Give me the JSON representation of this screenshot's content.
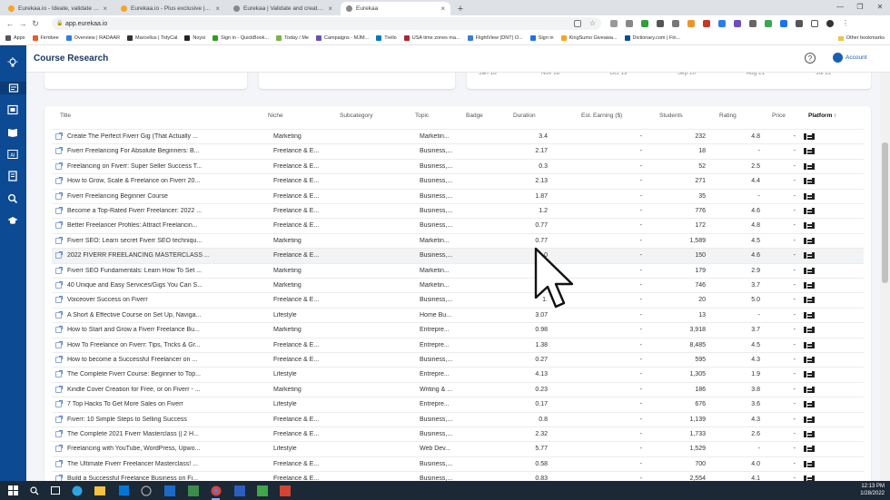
{
  "browser": {
    "tabs": [
      {
        "title": "Eurekaa.io - Ideate, validate & ...",
        "active": false,
        "favicon_color": "#f5a623"
      },
      {
        "title": "Eurekaa.io - Plus exclusive | App...",
        "active": false,
        "favicon_color": "#f5a623"
      },
      {
        "title": "Eurekaa | Validate and create co...",
        "active": false,
        "favicon_color": "#888888"
      },
      {
        "title": "Eurekaa",
        "active": true,
        "favicon_color": "#888888"
      }
    ],
    "url": "app.eurekaa.io",
    "bookmarks": [
      "Apps",
      "Firmbee",
      "Overview | RADAAR",
      "Marcellus | TidyCal",
      "Noysi",
      "Sign in - QuickBook...",
      "Today / Me",
      "Campaigns - MJM...",
      "Trello",
      "USA time zones ma...",
      "FlightView (DNT) O...",
      "Sign in",
      "KingSumo Giveawa...",
      "Dictionary.com | Fin..."
    ],
    "other_bookmarks": "Other bookmarks"
  },
  "app": {
    "title": "Course Research",
    "account_label": "Account",
    "help_icon": "?"
  },
  "chart_strip": {
    "dates": [
      "Jan 18",
      "Nov 18",
      "Oct 19",
      "Sep 20",
      "Aug 21",
      "Jul 22"
    ]
  },
  "table": {
    "columns": [
      "Title",
      "Niche",
      "Subcategory",
      "Topic",
      "Badge",
      "Duration",
      "Est. Earning ($)",
      "Students",
      "Rating",
      "Price",
      "Platform ↑"
    ],
    "rows": [
      {
        "title": "Create The Perfect Fiverr Gig (That Actually ...",
        "niche": "Marketing",
        "topic": "Marketin...",
        "duration": "3.4",
        "earning": "-",
        "students": "232",
        "rating": "4.8",
        "price": "-"
      },
      {
        "title": "Fiverr Freelancing For Absolute Beginners: B...",
        "niche": "Freelance & E...",
        "topic": "Business,...",
        "duration": "2.17",
        "earning": "-",
        "students": "18",
        "rating": "-",
        "price": "-"
      },
      {
        "title": "Freelancing on Fiverr: Super Seller Success T...",
        "niche": "Freelance & E...",
        "topic": "Business,...",
        "duration": "0.3",
        "earning": "-",
        "students": "52",
        "rating": "2.5",
        "price": "-"
      },
      {
        "title": "How to Grow, Scale & Freelance on Fiverr 20...",
        "niche": "Freelance & E...",
        "topic": "Business,...",
        "duration": "2.13",
        "earning": "-",
        "students": "271",
        "rating": "4.4",
        "price": "-"
      },
      {
        "title": "Fiverr Freelancing Beginner Course",
        "niche": "Freelance & E...",
        "topic": "Business,...",
        "duration": "1.87",
        "earning": "-",
        "students": "35",
        "rating": "-",
        "price": "-"
      },
      {
        "title": "Become a Top-Rated Fiverr Freelancer: 2022 ...",
        "niche": "Freelance & E...",
        "topic": "Business,...",
        "duration": "1.2",
        "earning": "-",
        "students": "776",
        "rating": "4.6",
        "price": "-"
      },
      {
        "title": "Better Freelancer Profiles: Attract Freelancin...",
        "niche": "Freelance & E...",
        "topic": "Business,...",
        "duration": "0.77",
        "earning": "-",
        "students": "172",
        "rating": "4.8",
        "price": "-"
      },
      {
        "title": "Fiverr SEO: Learn secret Fiverr SEO techniqu...",
        "niche": "Marketing",
        "topic": "Marketin...",
        "duration": "0.77",
        "earning": "-",
        "students": "1,589",
        "rating": "4.5",
        "price": "-"
      },
      {
        "title": "2022 FIVERR FREELANCING MASTERCLASS ...",
        "niche": "Freelance & E...",
        "topic": "Business,...",
        "duration": "0",
        "earning": "-",
        "students": "150",
        "rating": "4.6",
        "price": "-"
      },
      {
        "title": "Fiverr SEO Fundamentals: Learn How To Set ...",
        "niche": "Marketing",
        "topic": "Marketin...",
        "duration": "",
        "earning": "-",
        "students": "179",
        "rating": "2.9",
        "price": "-"
      },
      {
        "title": "40 Unique and Easy Services/Gigs You Can S...",
        "niche": "Marketing",
        "topic": "Marketin...",
        "duration": "1.",
        "earning": "-",
        "students": "746",
        "rating": "3.7",
        "price": "-"
      },
      {
        "title": "Voiceover Success on Fiverr",
        "niche": "Freelance & E...",
        "topic": "Business,...",
        "duration": "1.",
        "earning": "-",
        "students": "20",
        "rating": "5.0",
        "price": "-"
      },
      {
        "title": "A Short & Effective Course on Set Up, Naviga...",
        "niche": "Lifestyle",
        "topic": "Home Bu...",
        "duration": "3.07",
        "earning": "-",
        "students": "13",
        "rating": "-",
        "price": "-"
      },
      {
        "title": "How to Start and Grow a Fiverr Freelance Bu...",
        "niche": "Marketing",
        "topic": "Entrepre...",
        "duration": "0.98",
        "earning": "-",
        "students": "3,918",
        "rating": "3.7",
        "price": "-"
      },
      {
        "title": "How To Freelance on Fiverr: Tips, Tricks & Gr...",
        "niche": "Freelance & E...",
        "topic": "Entrepre...",
        "duration": "1.38",
        "earning": "-",
        "students": "8,485",
        "rating": "4.5",
        "price": "-"
      },
      {
        "title": "How to become a Successful Freelancer on ...",
        "niche": "Freelance & E...",
        "topic": "Business,...",
        "duration": "0.27",
        "earning": "-",
        "students": "595",
        "rating": "4.3",
        "price": "-"
      },
      {
        "title": "The Complete Fiverr Course: Beginner to Top...",
        "niche": "Lifestyle",
        "topic": "Entrepre...",
        "duration": "4.13",
        "earning": "-",
        "students": "1,305",
        "rating": "1.9",
        "price": "-"
      },
      {
        "title": "Kindle Cover Creation for Free, or on Fiverr - ...",
        "niche": "Marketing",
        "topic": "Writing & ...",
        "duration": "0.23",
        "earning": "-",
        "students": "186",
        "rating": "3.8",
        "price": "-"
      },
      {
        "title": "7 Top Hacks To Get More Sales on Fiverr",
        "niche": "Lifestyle",
        "topic": "Entrepre...",
        "duration": "0.17",
        "earning": "-",
        "students": "676",
        "rating": "3.6",
        "price": "-"
      },
      {
        "title": "Fiverr: 10 Simple Steps to Selling Success",
        "niche": "Freelance & E...",
        "topic": "Business,...",
        "duration": "0.8",
        "earning": "-",
        "students": "1,139",
        "rating": "4.3",
        "price": "-"
      },
      {
        "title": "The Complete 2021 Fiverr Masterclass || 2 H...",
        "niche": "Freelance & E...",
        "topic": "Business,...",
        "duration": "2.32",
        "earning": "-",
        "students": "1,733",
        "rating": "2.6",
        "price": "-"
      },
      {
        "title": "Freelancing with YouTube, WordPress, Upwo...",
        "niche": "Lifestyle",
        "topic": "Web Dev...",
        "duration": "5.77",
        "earning": "-",
        "students": "1,529",
        "rating": "-",
        "price": "-"
      },
      {
        "title": "The Ultimate Fiverr Freelancer Masterclass! ...",
        "niche": "Freelance & E...",
        "topic": "Business,...",
        "duration": "0.58",
        "earning": "-",
        "students": "700",
        "rating": "4.0",
        "price": "-"
      },
      {
        "title": "Build a Successful Freelance Business on Fi...",
        "niche": "Freelance & E...",
        "topic": "Business,...",
        "duration": "0.83",
        "earning": "-",
        "students": "2,554",
        "rating": "4.1",
        "price": "-"
      }
    ]
  },
  "taskbar": {
    "time": "12:13 PM",
    "date": "1/28/2022"
  },
  "colors": {
    "sidebar": "#0c4a93",
    "title": "#1a3763",
    "accent": "#1a5fb4"
  }
}
